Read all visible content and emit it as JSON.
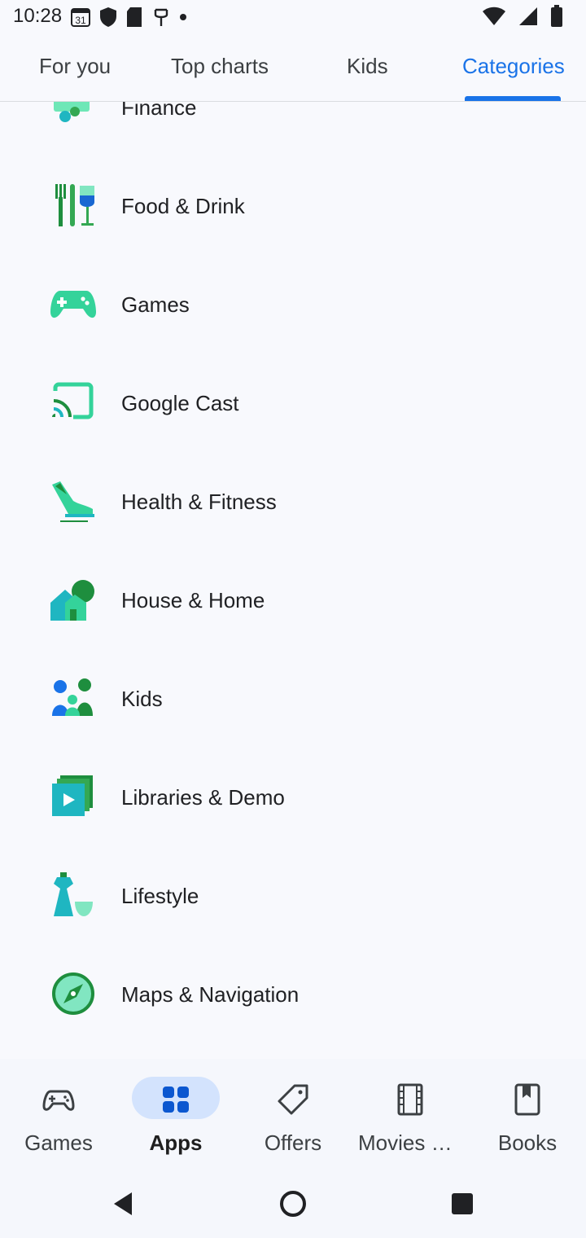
{
  "status_bar": {
    "time": "10:28",
    "notification_icons": [
      "calendar-icon",
      "shield-icon",
      "sd-card-icon",
      "usb-icon",
      "dot-icon"
    ],
    "calendar_day": "31",
    "right_icons": [
      "wifi-icon",
      "signal-icon",
      "battery-icon"
    ]
  },
  "top_tabs": [
    {
      "label": "For you"
    },
    {
      "label": "Top charts"
    },
    {
      "label": "Kids"
    },
    {
      "label": "Categories",
      "active": true
    }
  ],
  "categories": [
    {
      "label": "Finance",
      "icon": "finance-icon"
    },
    {
      "label": "Food & Drink",
      "icon": "food-drink-icon"
    },
    {
      "label": "Games",
      "icon": "gamepad-icon"
    },
    {
      "label": "Google Cast",
      "icon": "cast-icon"
    },
    {
      "label": "Health & Fitness",
      "icon": "sneaker-icon"
    },
    {
      "label": "House & Home",
      "icon": "house-icon"
    },
    {
      "label": "Kids",
      "icon": "kids-icon"
    },
    {
      "label": "Libraries & Demo",
      "icon": "library-icon"
    },
    {
      "label": "Lifestyle",
      "icon": "lifestyle-icon"
    },
    {
      "label": "Maps & Navigation",
      "icon": "compass-icon"
    }
  ],
  "bottom_nav": [
    {
      "label": "Games",
      "icon": "gamepad-icon"
    },
    {
      "label": "Apps",
      "icon": "apps-grid-icon",
      "active": true
    },
    {
      "label": "Offers",
      "icon": "tag-icon"
    },
    {
      "label": "Movies & TV",
      "icon": "film-icon"
    },
    {
      "label": "Books",
      "icon": "book-icon"
    }
  ],
  "system_nav": [
    "back-icon",
    "home-icon",
    "recents-icon"
  ],
  "colors": {
    "accent": "#1a73e8",
    "background": "#f8f9fd",
    "active_pill": "#d3e3fd"
  }
}
